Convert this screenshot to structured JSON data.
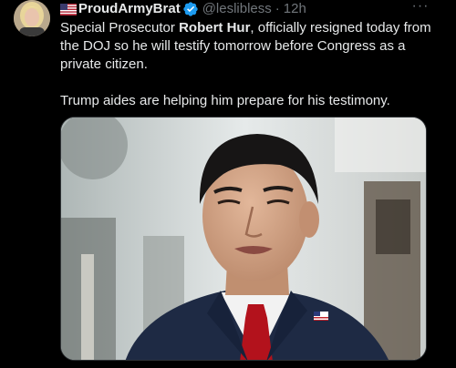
{
  "tweet": {
    "display_name": "ProudArmyBrat",
    "handle": "@leslibless",
    "separator": "·",
    "time": "12h",
    "more": "···",
    "body": {
      "line1_prefix": "Special Prosecutor ",
      "line1_bold": "Robert Hur",
      "line1_rest": ", officially resigned today from the DOJ so he will testify tomorrow before Congress as a private citizen.",
      "line2": "Trump aides are helping him prepare for his testimony."
    },
    "icons": {
      "flag": "us-flag-icon",
      "verified": "verified-badge-icon",
      "more": "more-options-icon"
    }
  },
  "colors": {
    "background": "#000000",
    "text": "#e7e9ea",
    "muted": "#71767b",
    "verified": "#1d9bf0"
  }
}
